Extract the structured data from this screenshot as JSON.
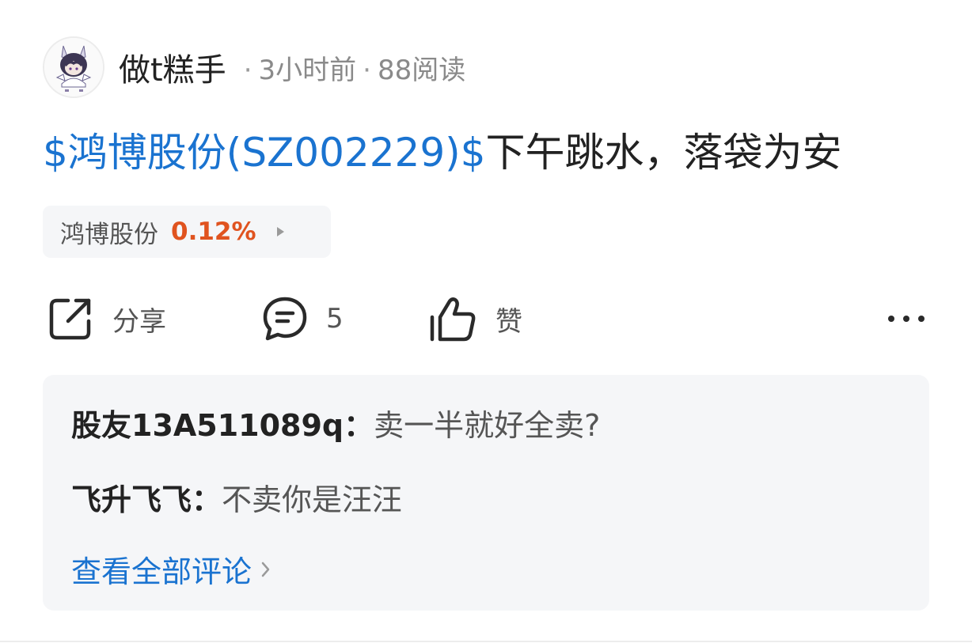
{
  "post": {
    "author": {
      "name": "做t糕手",
      "avatar_icon": "anime-avatar-icon"
    },
    "time_ago": "3小时前",
    "views": "88阅读",
    "separator": "·",
    "title": {
      "stock_link": "$鸿博股份(SZ002229)$",
      "text": "下午跳水，落袋为安"
    },
    "stock_chip": {
      "name": "鸿博股份",
      "change": "0.12%",
      "arrow_icon": "play-arrow-icon"
    }
  },
  "actions": {
    "share": {
      "label": "分享",
      "icon": "share-icon"
    },
    "comment": {
      "count": "5",
      "icon": "comment-bubble-icon"
    },
    "like": {
      "label": "赞",
      "icon": "thumbs-up-icon"
    },
    "more": {
      "icon": "more-dots-icon"
    }
  },
  "comments": {
    "items": [
      {
        "author": "股友13A511089q",
        "colon": "：",
        "content": "卖一半就好全卖?"
      },
      {
        "author": "飞升飞飞",
        "colon": "：",
        "content": "不卖你是汪汪"
      }
    ],
    "view_all": "查看全部评论"
  },
  "colors": {
    "link_blue": "#1a73d0",
    "change_red": "#e0531f",
    "panel_gray": "#f5f6f8",
    "muted_text": "#8a8a8a"
  }
}
